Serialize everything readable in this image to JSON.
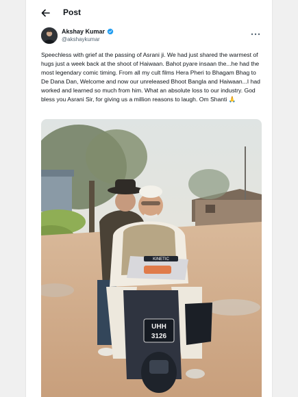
{
  "header": {
    "title": "Post",
    "back_icon": "arrow-left-icon"
  },
  "author": {
    "name": "Akshay Kumar",
    "handle": "@akshaykumar",
    "verified": true,
    "verified_color": "#1d9bf0"
  },
  "more_icon": "more-horizontal-icon",
  "tweet": {
    "text": "Speechless with grief at the passing of Asrani ji. We had just shared the warmest of hugs just a week back at the shoot of Haiwaan. Bahot pyare insaan the...he had the most legendary comic timing. From all my cult films Hera Pheri to Bhagam Bhag to De Dana Dan, Welcome and now our unreleased Bhoot Bangla and Haiwaan...I had worked and learned so much from him. What an absolute loss to our industry. God bless you Asrani Sir, for giving us a million reasons to laugh. Om Shanti 🙏"
  },
  "media": {
    "scooter_brand": "KINETIC",
    "plate_top": "UHH",
    "plate_bottom": "3126"
  }
}
